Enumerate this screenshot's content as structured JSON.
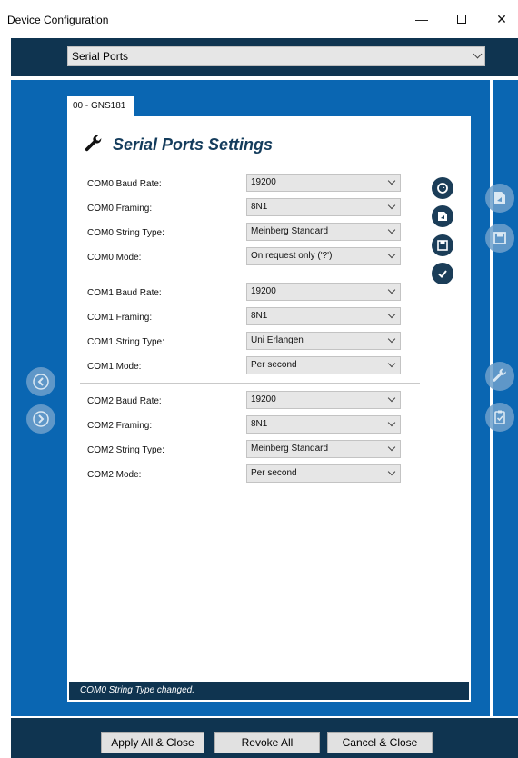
{
  "window": {
    "title": "Device Configuration",
    "minimize": "—",
    "close": "✕"
  },
  "header": {
    "section_select": "Serial Ports"
  },
  "tab": {
    "label": "00 - GNS181"
  },
  "panel": {
    "title": "Serial Ports Settings",
    "groups": [
      {
        "rows": [
          {
            "label": "COM0 Baud Rate:",
            "value": "19200"
          },
          {
            "label": "COM0 Framing:",
            "value": "8N1"
          },
          {
            "label": "COM0 String Type:",
            "value": "Meinberg Standard"
          },
          {
            "label": "COM0 Mode:",
            "value": "On request only ('?')"
          }
        ]
      },
      {
        "rows": [
          {
            "label": "COM1 Baud Rate:",
            "value": "19200"
          },
          {
            "label": "COM1 Framing:",
            "value": "8N1"
          },
          {
            "label": "COM1 String Type:",
            "value": "Uni Erlangen"
          },
          {
            "label": "COM1 Mode:",
            "value": "Per second"
          }
        ]
      },
      {
        "rows": [
          {
            "label": "COM2 Baud Rate:",
            "value": "19200"
          },
          {
            "label": "COM2 Framing:",
            "value": "8N1"
          },
          {
            "label": "COM2 String Type:",
            "value": "Meinberg Standard"
          },
          {
            "label": "COM2 Mode:",
            "value": "Per second"
          }
        ]
      }
    ]
  },
  "status": {
    "message": "COM0 String Type changed."
  },
  "footer": {
    "apply": "Apply All & Close",
    "revoke": "Revoke All",
    "cancel": "Cancel & Close"
  },
  "icons": {
    "panel_buttons": [
      "reset-icon",
      "load-file-icon",
      "save-icon",
      "check-icon"
    ],
    "side_right": [
      "load-file-icon",
      "save-icon",
      "wrench-icon",
      "clipboard-check-icon"
    ],
    "side_left": [
      "prev-icon",
      "next-icon"
    ]
  },
  "colors": {
    "accent_blue": "#0a66b2",
    "dark_navy": "#0f3450",
    "heading": "#143c5c"
  }
}
